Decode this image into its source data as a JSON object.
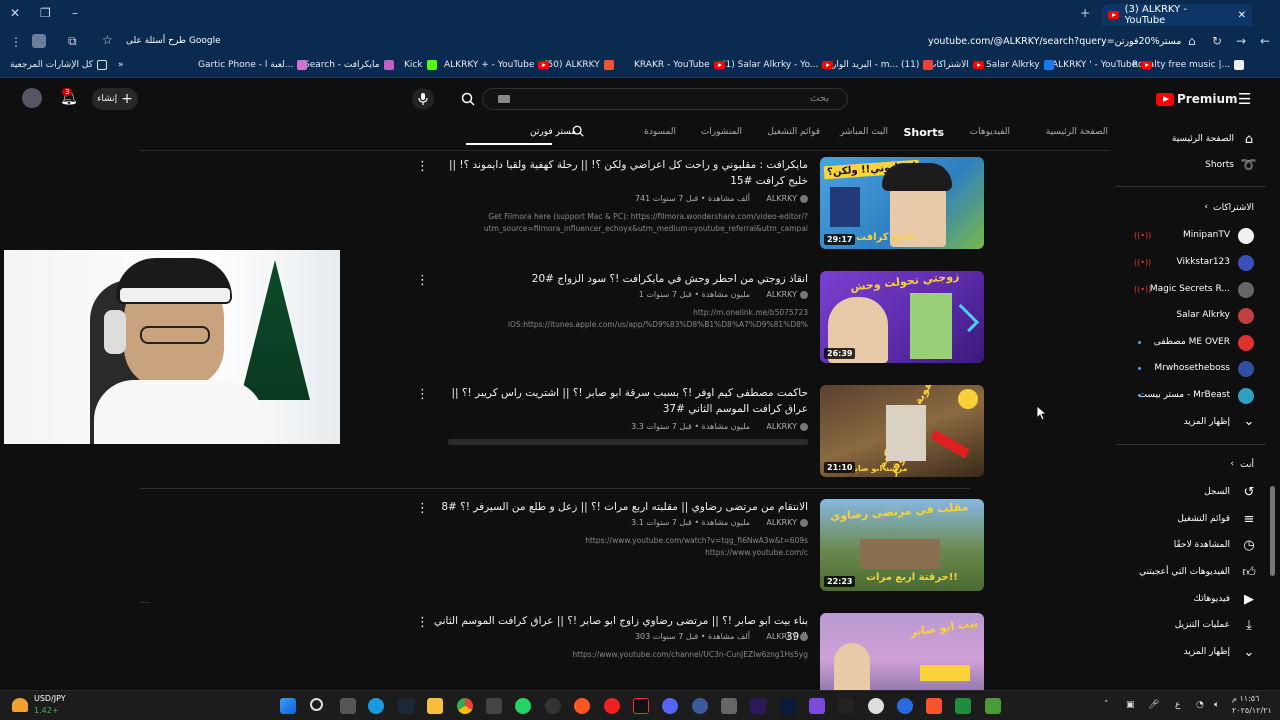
{
  "browser": {
    "tab_title": "(3) ALKRKY - YouTube",
    "new_tab": "+",
    "url": "youtube.com/@ALKRKY/search?query=مستر%20فورتن",
    "ask_google": "طرح أسئلة على Google",
    "bookmarks": [
      "Royalty free music |...",
      "ALKRKY ' - YouTube",
      "Salar Alkrky",
      "الاشتراكات",
      "البريد الوارد - m... (11)",
      "(1) Salar Alkrky - Yo...",
      "KRAKR - YouTube",
      "(50) ALKRKY",
      "ALKRKY + - YouTube",
      "Kick",
      "Search - مايكرافت",
      "Gartic Phone - لعبة ا..."
    ],
    "all_bookmarks": "كل الإشارات المرجعية"
  },
  "masthead": {
    "search_placeholder": "بحث",
    "create_label": "إنشاء",
    "notif_count": "3",
    "logo_text": "Premium"
  },
  "channel_tabs": {
    "home": "الصفحة الرئيسية",
    "videos": "الفيديوهات",
    "shorts": "Shorts",
    "live": "البث المباشر",
    "playlists": "قوائم التشغيل",
    "posts": "المنشورات",
    "shows": "المسودة",
    "search_query": "مستر فورتن"
  },
  "sidebar": {
    "home": "الصفحة الرئيسية",
    "shorts": "Shorts",
    "subs_header": "الاشتراكات",
    "subs": [
      {
        "name": "MinipanTV",
        "live": true,
        "color": "#f0f0f0"
      },
      {
        "name": "Vikkstar123",
        "live": true,
        "color": "#3b4fb8"
      },
      {
        "name": "Magic Secrets R...",
        "live": true,
        "color": "#666666"
      },
      {
        "name": "Salar Alkrky",
        "live": false,
        "color": "#c04040"
      },
      {
        "name": "مصطفى ME OVER",
        "live": false,
        "color": "#e03030"
      },
      {
        "name": "Mrwhosetheboss",
        "live": false,
        "color": "#3050a0"
      },
      {
        "name": "مستر بيست - MrBeast",
        "live": false,
        "color": "#30a0c0"
      }
    ],
    "show_more": "إظهار المزيد",
    "you_header": "أنت",
    "you_items": [
      "السجل",
      "قوائم التشغيل",
      "المشاهدة لاحقًا",
      "الفيديوهات التي أعجبتني",
      "فيديوهاتك",
      "عمليات التنزيل",
      "إظهار المزيد"
    ]
  },
  "results": [
    {
      "title": "مايكرافت : مقلبوني و راحت كل اعراضي ولكن ؟! || رحلة كهفية ولقيا دايموند ؟! || خليج كرافت #15",
      "channel": "ALKRKY",
      "meta": "741 ألف مشاهدة • قبل 7 سنوات",
      "desc1": "Get Filmora here (support Mac & PC): https://filmora.wondershare.com/video-editor/?",
      "desc2": "utm_source=filmora_influencer_echoyx&utm_medium=youtube_referral&utm_campai",
      "duration": "29:17",
      "thumb_text": "مقلبوني!! ولكن؟!",
      "thumb_text2": "خليج كرافت"
    },
    {
      "title": "انقاذ زوجتي من احطر وحش في مايكرافت !؟ سود الزواج #20",
      "channel": "ALKRKY",
      "meta": "1 مليون مشاهدة • قبل 7 سنوات",
      "desc1": "http://m.onelink.me/b5075723",
      "desc2": "iOS:https://itunes.apple.com/us/app/%D9%83%D8%B1%D8%A7%D9%81%D8%",
      "duration": "26:39",
      "thumb_text": "زوجتي تحولت وحش",
      "thumb_text2": ""
    },
    {
      "title": "حاكمت مصطفى كيم اوفر !؟ بسبب سرقة ابو صابر !؟ || اشتريت راس كريبر !؟ || عراق كرافت الموسم الثاني #37",
      "channel": "ALKRKY",
      "meta": "3.3 مليون مشاهدة • قبل 7 سنوات",
      "desc1": "",
      "desc2": "",
      "duration": "21:10",
      "thumb_text": "عقوبة مصطفى كيم اوفر",
      "thumb_text2": "مرشد ابو صابر"
    },
    {
      "title": "الانتقام من مرتضى رضاوي || مقلبته اربع مرات !؟ || زعل و طلع من السيرفر !؟ #8",
      "channel": "ALKRKY",
      "meta": "3.1 مليون مشاهدة • قبل 7 سنوات",
      "desc1": "https://www.youtube.com/watch?v=tqg_fi6NwA3w&t=609s",
      "desc2": "https://www.youtube.com/c",
      "duration": "22:23",
      "thumb_text": "مقلب في مرتضى رضاوي",
      "thumb_text2": "حرقتة اربع مرات!!"
    },
    {
      "title": "بناء بيت ابو صابر !؟ || مرتضى رضاوي زاوج ابو صابر !؟ || عراق كرافت الموسم الثاني #39",
      "channel": "ALKRKY",
      "meta": "303 ألف مشاهدة • قبل 7 سنوات",
      "desc1": "https://www.youtube.com/channel/UC3n-CunJEZIw6zng1Hs5yg",
      "desc2": "",
      "duration": "",
      "thumb_text": "بيت ابو صابر",
      "thumb_text2": ""
    }
  ],
  "taskbar": {
    "ticker": "USD/JPY",
    "ticker_val": "1.42+",
    "time": "١١:٥٦ م",
    "date": "٢٠٢٥/١٢/٢١",
    "lang": "ع"
  },
  "colors": {
    "bg": "#0f0f0f",
    "chrome": "#0b2a4f",
    "accent_red": "#ff0000"
  }
}
